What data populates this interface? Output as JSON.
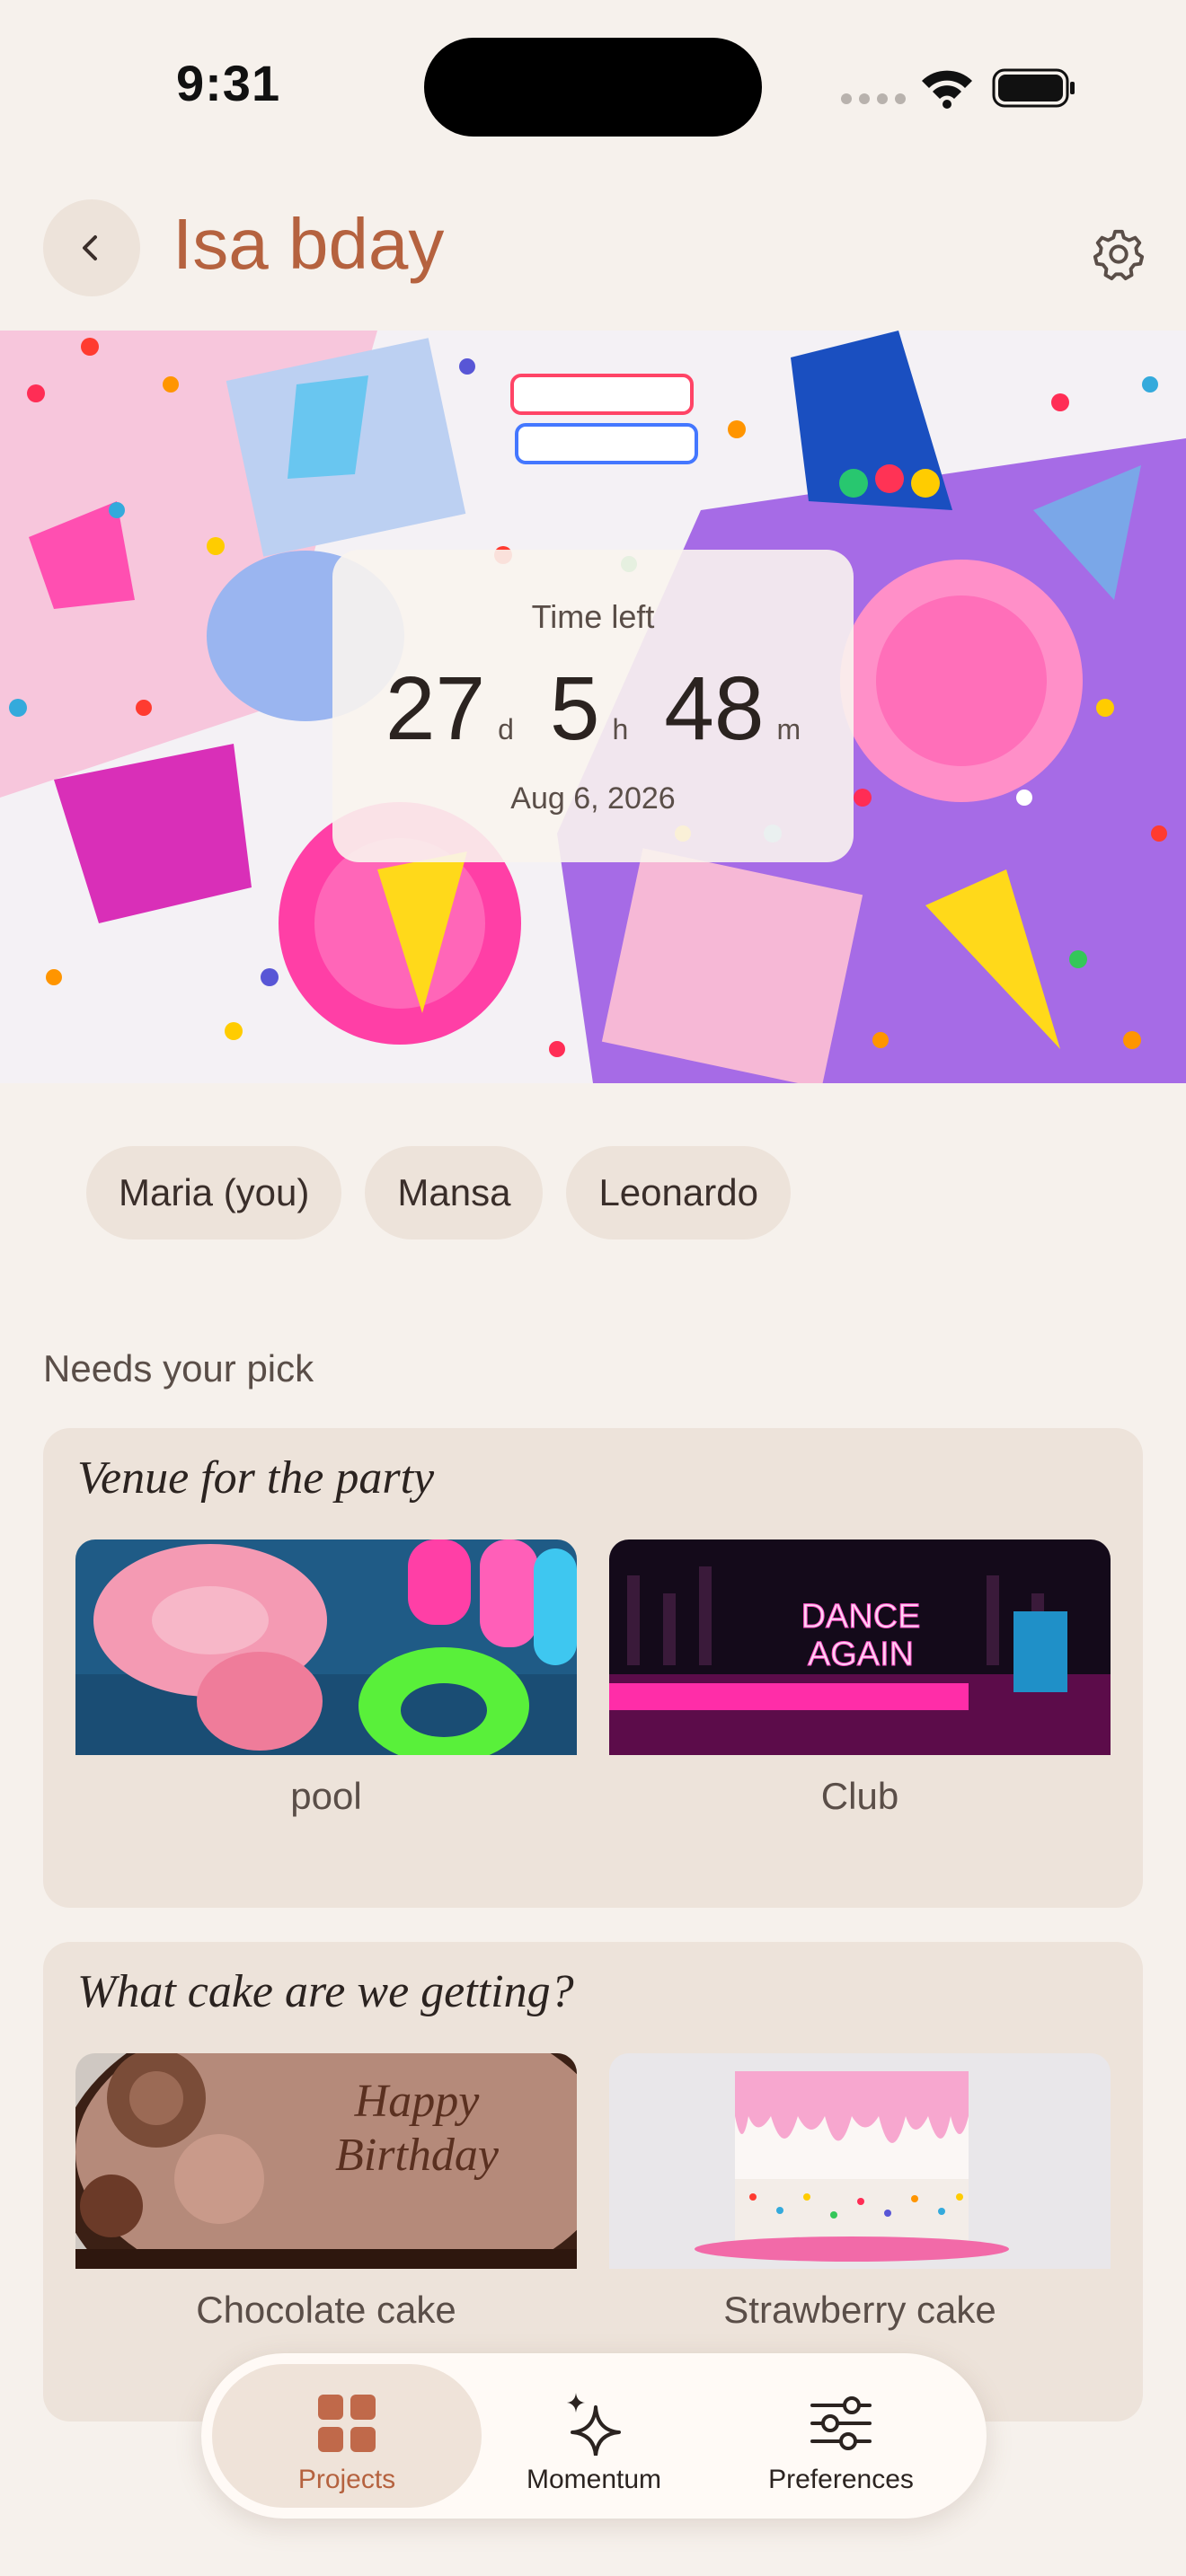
{
  "status_bar": {
    "time": "9:31"
  },
  "header": {
    "title": "Isa bday"
  },
  "countdown": {
    "label": "Time left",
    "days": "27",
    "days_unit": "d",
    "hours": "5",
    "hours_unit": "h",
    "minutes": "48",
    "minutes_unit": "m",
    "date": "Aug 6, 2026"
  },
  "members": [
    "Maria (you)",
    "Mansa",
    "Leonardo"
  ],
  "section": {
    "title": "Needs your pick"
  },
  "polls": [
    {
      "question": "Venue for the party",
      "options": [
        {
          "label": "pool"
        },
        {
          "label": "Club",
          "sign_line1": "DANCE",
          "sign_line2": "AGAIN"
        }
      ]
    },
    {
      "question": "What cake are we getting?",
      "options": [
        {
          "label": "Chocolate cake",
          "writing_line1": "Happy",
          "writing_line2": "Birthday"
        },
        {
          "label": "Strawberry cake"
        }
      ]
    }
  ],
  "nav": {
    "items": [
      {
        "label": "Projects",
        "icon": "grid-icon",
        "active": true
      },
      {
        "label": "Momentum",
        "icon": "sparkle-icon",
        "active": false
      },
      {
        "label": "Preferences",
        "icon": "sliders-icon",
        "active": false
      }
    ]
  },
  "colors": {
    "accent": "#b5623f",
    "background": "#f6f1ec",
    "card": "#ede3da"
  }
}
